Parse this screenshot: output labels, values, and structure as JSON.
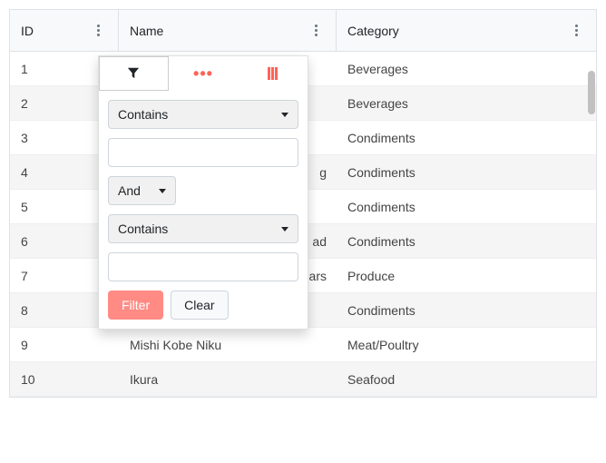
{
  "columns": {
    "id": "ID",
    "name": "Name",
    "category": "Category"
  },
  "rows": [
    {
      "id": "1",
      "name": "",
      "category": "Beverages"
    },
    {
      "id": "2",
      "name": "",
      "category": "Beverages"
    },
    {
      "id": "3",
      "name": "",
      "category": "Condiments"
    },
    {
      "id": "4",
      "name": "g",
      "category": "Condiments"
    },
    {
      "id": "5",
      "name": "",
      "category": "Condiments"
    },
    {
      "id": "6",
      "name": "ad",
      "category": "Condiments"
    },
    {
      "id": "7",
      "name": "ears",
      "category": "Produce"
    },
    {
      "id": "8",
      "name": "",
      "category": "Condiments"
    },
    {
      "id": "9",
      "name": "Mishi Kobe Niku",
      "category": "Meat/Poultry"
    },
    {
      "id": "10",
      "name": "Ikura",
      "category": "Seafood"
    }
  ],
  "filter": {
    "operator1": "Contains",
    "value1": "",
    "logic": "And",
    "operator2": "Contains",
    "value2": "",
    "filterBtn": "Filter",
    "clearBtn": "Clear"
  }
}
